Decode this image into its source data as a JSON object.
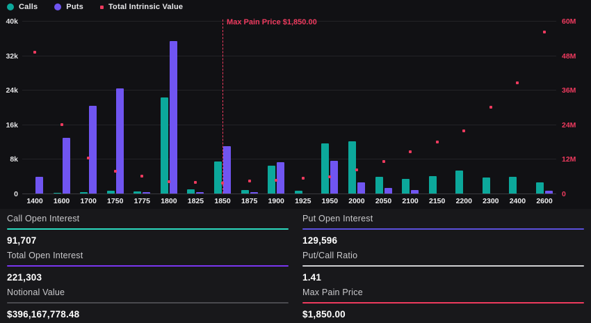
{
  "legend": {
    "items": [
      {
        "label": "Calls",
        "color": "#0ca89b",
        "shape": "circle"
      },
      {
        "label": "Puts",
        "color": "#7055f1",
        "shape": "circle"
      },
      {
        "label": "Total Intrinsic Value",
        "color": "#ee3a5e",
        "shape": "square"
      }
    ]
  },
  "chart_data": {
    "type": "bar",
    "categories": [
      "1400",
      "1600",
      "1700",
      "1750",
      "1775",
      "1800",
      "1825",
      "1850",
      "1875",
      "1900",
      "1925",
      "1950",
      "2000",
      "2050",
      "2100",
      "2150",
      "2200",
      "2300",
      "2400",
      "2600"
    ],
    "series": [
      {
        "name": "Calls",
        "type": "bar",
        "axis": "left",
        "color": "#0ca89b",
        "values": [
          0,
          150,
          400,
          650,
          500,
          22200,
          1000,
          7400,
          750,
          6400,
          600,
          11600,
          12100,
          3900,
          3400,
          4000,
          5400,
          3700,
          3900,
          2500
        ]
      },
      {
        "name": "Puts",
        "type": "bar",
        "axis": "left",
        "color": "#7055f1",
        "values": [
          3800,
          12900,
          20400,
          24300,
          350,
          35400,
          300,
          11000,
          350,
          7200,
          0,
          7600,
          2600,
          1300,
          850,
          0,
          0,
          0,
          0,
          600
        ]
      },
      {
        "name": "Total Intrinsic Value",
        "type": "scatter",
        "axis": "right",
        "color": "#ee3a5e",
        "unit": "M",
        "values": [
          49.1,
          23.9,
          12.3,
          7.8,
          6.0,
          4.1,
          3.9,
          3.7,
          4.4,
          4.6,
          5.4,
          5.9,
          8.2,
          11.2,
          14.6,
          18.0,
          21.8,
          29.9,
          38.5,
          56.2
        ]
      }
    ],
    "left_axis": {
      "max": 40000,
      "ticks": [
        [
          0,
          "0"
        ],
        [
          8000,
          "8k"
        ],
        [
          16000,
          "16k"
        ],
        [
          24000,
          "24k"
        ],
        [
          32000,
          "32k"
        ],
        [
          40000,
          "40k"
        ]
      ],
      "color": "#e2e2e4"
    },
    "right_axis": {
      "max": 60,
      "ticks": [
        [
          0,
          "0"
        ],
        [
          12,
          "12M"
        ],
        [
          24,
          "24M"
        ],
        [
          36,
          "36M"
        ],
        [
          48,
          "48M"
        ],
        [
          60,
          "60M"
        ]
      ],
      "color": "#ee3a5e"
    },
    "annotation": {
      "label": "Max Pain Price $1,850.00",
      "category": "1850",
      "color": "#ee3a5e"
    },
    "grid": true,
    "legend_position": "top-left"
  },
  "stats": {
    "items": [
      {
        "label": "Call Open Interest",
        "value": "91,707",
        "color": "#2bd9bf"
      },
      {
        "label": "Put Open Interest",
        "value": "129,596",
        "color": "#5b50dd"
      },
      {
        "label": "Total Open Interest",
        "value": "221,303",
        "color": "#7a36f0"
      },
      {
        "label": "Put/Call Ratio",
        "value": "1.41",
        "color": "#cfcfd2"
      },
      {
        "label": "Notional Value",
        "value": "$396,167,778.48",
        "color": "#4a4a4f"
      },
      {
        "label": "Max Pain Price",
        "value": "$1,850.00",
        "color": "#ee3a5e"
      }
    ]
  }
}
